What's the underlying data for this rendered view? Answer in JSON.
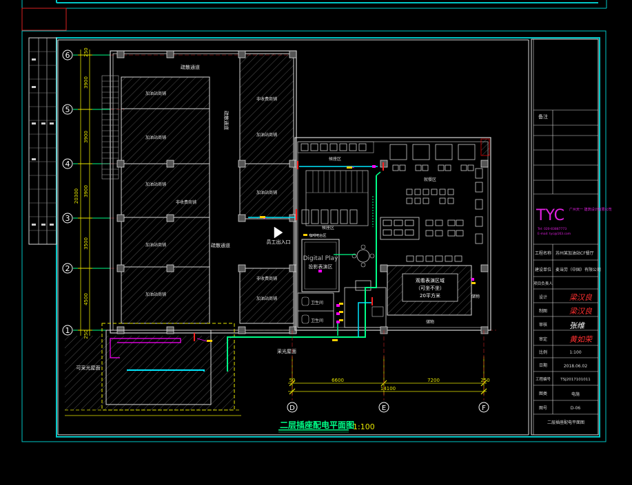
{
  "drawing": {
    "title": "二层插座配电平面图",
    "scale": "1:100"
  },
  "grid_rows": [
    {
      "label": "6"
    },
    {
      "label": "5"
    },
    {
      "label": "4"
    },
    {
      "label": "3"
    },
    {
      "label": "2"
    },
    {
      "label": "1"
    }
  ],
  "grid_cols": [
    {
      "label": "D"
    },
    {
      "label": "E"
    },
    {
      "label": "F"
    }
  ],
  "dimensions": {
    "left": [
      "250",
      "3900",
      "3900",
      "3900",
      "3500",
      "4500",
      "250"
    ],
    "left_total": "20300",
    "bottom": [
      "50",
      "6600",
      "7200",
      "250"
    ],
    "bottom_total": "14100"
  },
  "rooms": {
    "corridor_top": "疏散通道",
    "corridor_mid": "疏散通道",
    "corridor_vertical": "疏散通道",
    "room_a": "加油站商铺",
    "room_b": "加油站商铺",
    "room_c": "加油站商铺",
    "room_d": "非收费商铺",
    "room_e": "加油站商铺",
    "room_f": "非收费商铺",
    "room_g": "加油站商铺",
    "room_h": "非收费商铺",
    "room_i": "加油站商铺",
    "room_j": "加油站商铺",
    "waiting": "候座区",
    "waiting2": "候座区",
    "dining": "就餐区",
    "staff_entry": "员工出入口",
    "kitchen": "咖啡吧台区",
    "vip_title": "观看表演区域",
    "vip_sub": "（可坐不坐）",
    "vip_area": "20平方米",
    "stage_brand": "Digital Play",
    "stage_label": "投影表演区",
    "wc1": "卫生间",
    "wc2": "卫生间",
    "cabinet": "储物",
    "cabinet2": "储物",
    "terrace": "可采光屋面",
    "roof": "采光屋面"
  },
  "title_block": {
    "notes_label": "备注",
    "company_logo": "TYC",
    "company_name": "广州天一 建筑设计有限公司",
    "company_tel": "Tel: 020-83887773",
    "company_email": "E-mail: tyc@163.com",
    "rows": [
      {
        "label": "工程名称",
        "value": "苏州某加油站CF餐厅"
      },
      {
        "label": "建设单位",
        "value": "麦当劳（中国）有限公司"
      },
      {
        "label": "项目负责人",
        "value": ""
      },
      {
        "label": "设计",
        "value": "梁汉良"
      },
      {
        "label": "制图",
        "value": "梁汉良"
      },
      {
        "label": "审核",
        "value": "张维"
      },
      {
        "label": "审定",
        "value": "黄如荣"
      },
      {
        "label": "比例",
        "value": "1:100"
      },
      {
        "label": "日期",
        "value": "2018.06.02"
      },
      {
        "label": "工程编号",
        "value": "TSJ2017101011"
      },
      {
        "label": "图类",
        "value": "电施"
      },
      {
        "label": "图号",
        "value": "D-06"
      }
    ],
    "drawing_name": "二层插座配电平面图"
  },
  "colors": {
    "frame": "#00c8c8",
    "wall": "#d8d8d8",
    "power_line": "#00ff88",
    "cyan_line": "#00e8ff",
    "socket": "#ff00ff",
    "accent_red": "#ff2020",
    "dim": "#e8e800",
    "highlight": "#ffff00"
  }
}
